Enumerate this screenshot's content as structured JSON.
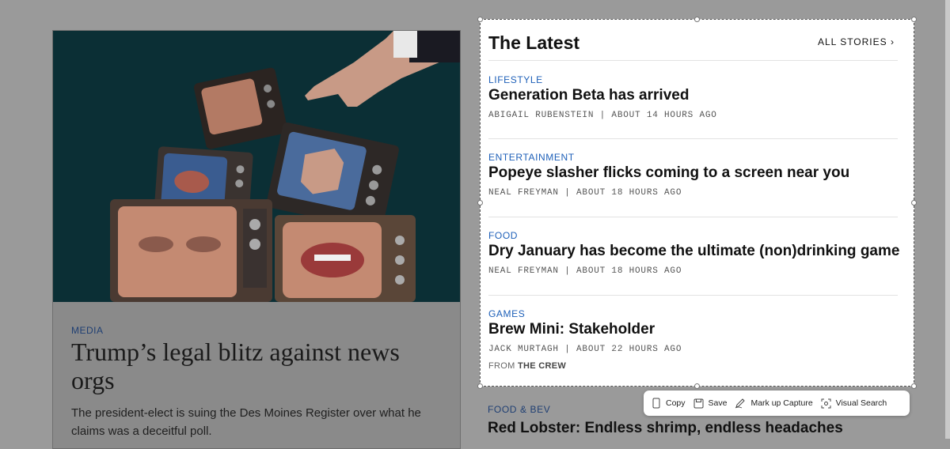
{
  "feature": {
    "kicker": "MEDIA",
    "title": "Trump’s legal blitz against news orgs",
    "dek": "The president-elect is suing the Des Moines Register over what he claims was a deceitful poll."
  },
  "latest": {
    "title": "The Latest",
    "all_stories": "ALL STORIES",
    "stories": [
      {
        "category": "LIFESTYLE",
        "headline": "Generation Beta has arrived",
        "byline": "ABIGAIL RUBENSTEIN | ABOUT 14 HOURS AGO"
      },
      {
        "category": "ENTERTAINMENT",
        "headline": "Popeye slasher flicks coming to a screen near you",
        "byline": "NEAL FREYMAN | ABOUT 18 HOURS AGO"
      },
      {
        "category": "FOOD",
        "headline": "Dry January has become the ultimate (non)drinking game",
        "byline": "NEAL FREYMAN | ABOUT 18 HOURS AGO"
      },
      {
        "category": "GAMES",
        "headline": "Brew Mini: Stakeholder",
        "byline": "JACK MURTAGH | ABOUT 22 HOURS AGO",
        "from_prefix": "FROM",
        "from_name": "THE CREW"
      }
    ]
  },
  "below": {
    "category": "FOOD & BEV",
    "headline": "Red Lobster: Endless shrimp, endless headaches"
  },
  "toolbar": {
    "copy": "Copy",
    "save": "Save",
    "markup": "Mark up Capture",
    "visual_search": "Visual Search"
  },
  "colors": {
    "dim_overlay": "#9a9a9a",
    "category_blue": "#1d5fb8",
    "image_bg": "#0b2f35"
  }
}
